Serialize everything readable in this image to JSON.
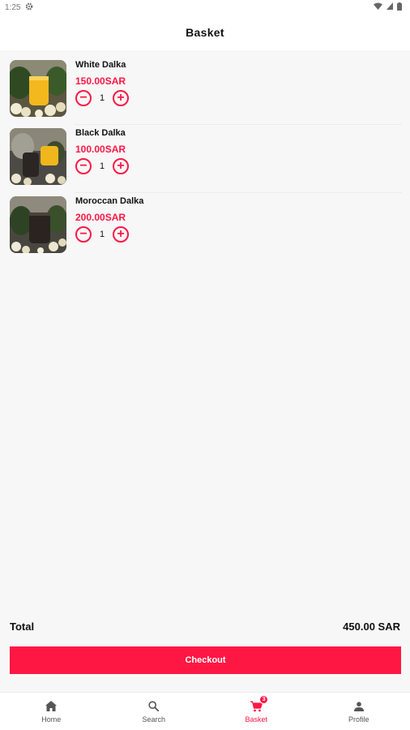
{
  "status_bar": {
    "time": "1:25"
  },
  "header": {
    "title": "Basket"
  },
  "items": [
    {
      "name": "White Dalka",
      "price": "150.00SAR",
      "quantity": "1",
      "minus": "−",
      "plus": "+"
    },
    {
      "name": "Black Dalka",
      "price": "100.00SAR",
      "quantity": "1",
      "minus": "−",
      "plus": "+"
    },
    {
      "name": "Moroccan Dalka",
      "price": "200.00SAR",
      "quantity": "1",
      "minus": "−",
      "plus": "+"
    }
  ],
  "summary": {
    "total_label": "Total",
    "total_value": "450.00 SAR"
  },
  "checkout": {
    "label": "Checkout"
  },
  "nav": {
    "items": [
      {
        "label": "Home",
        "icon": "home-icon"
      },
      {
        "label": "Search",
        "icon": "search-icon"
      },
      {
        "label": "Basket",
        "icon": "cart-icon",
        "badge": "3",
        "active": true
      },
      {
        "label": "Profile",
        "icon": "person-icon"
      }
    ]
  },
  "colors": {
    "accent": "#ff1744",
    "background": "#f7f7f7"
  }
}
